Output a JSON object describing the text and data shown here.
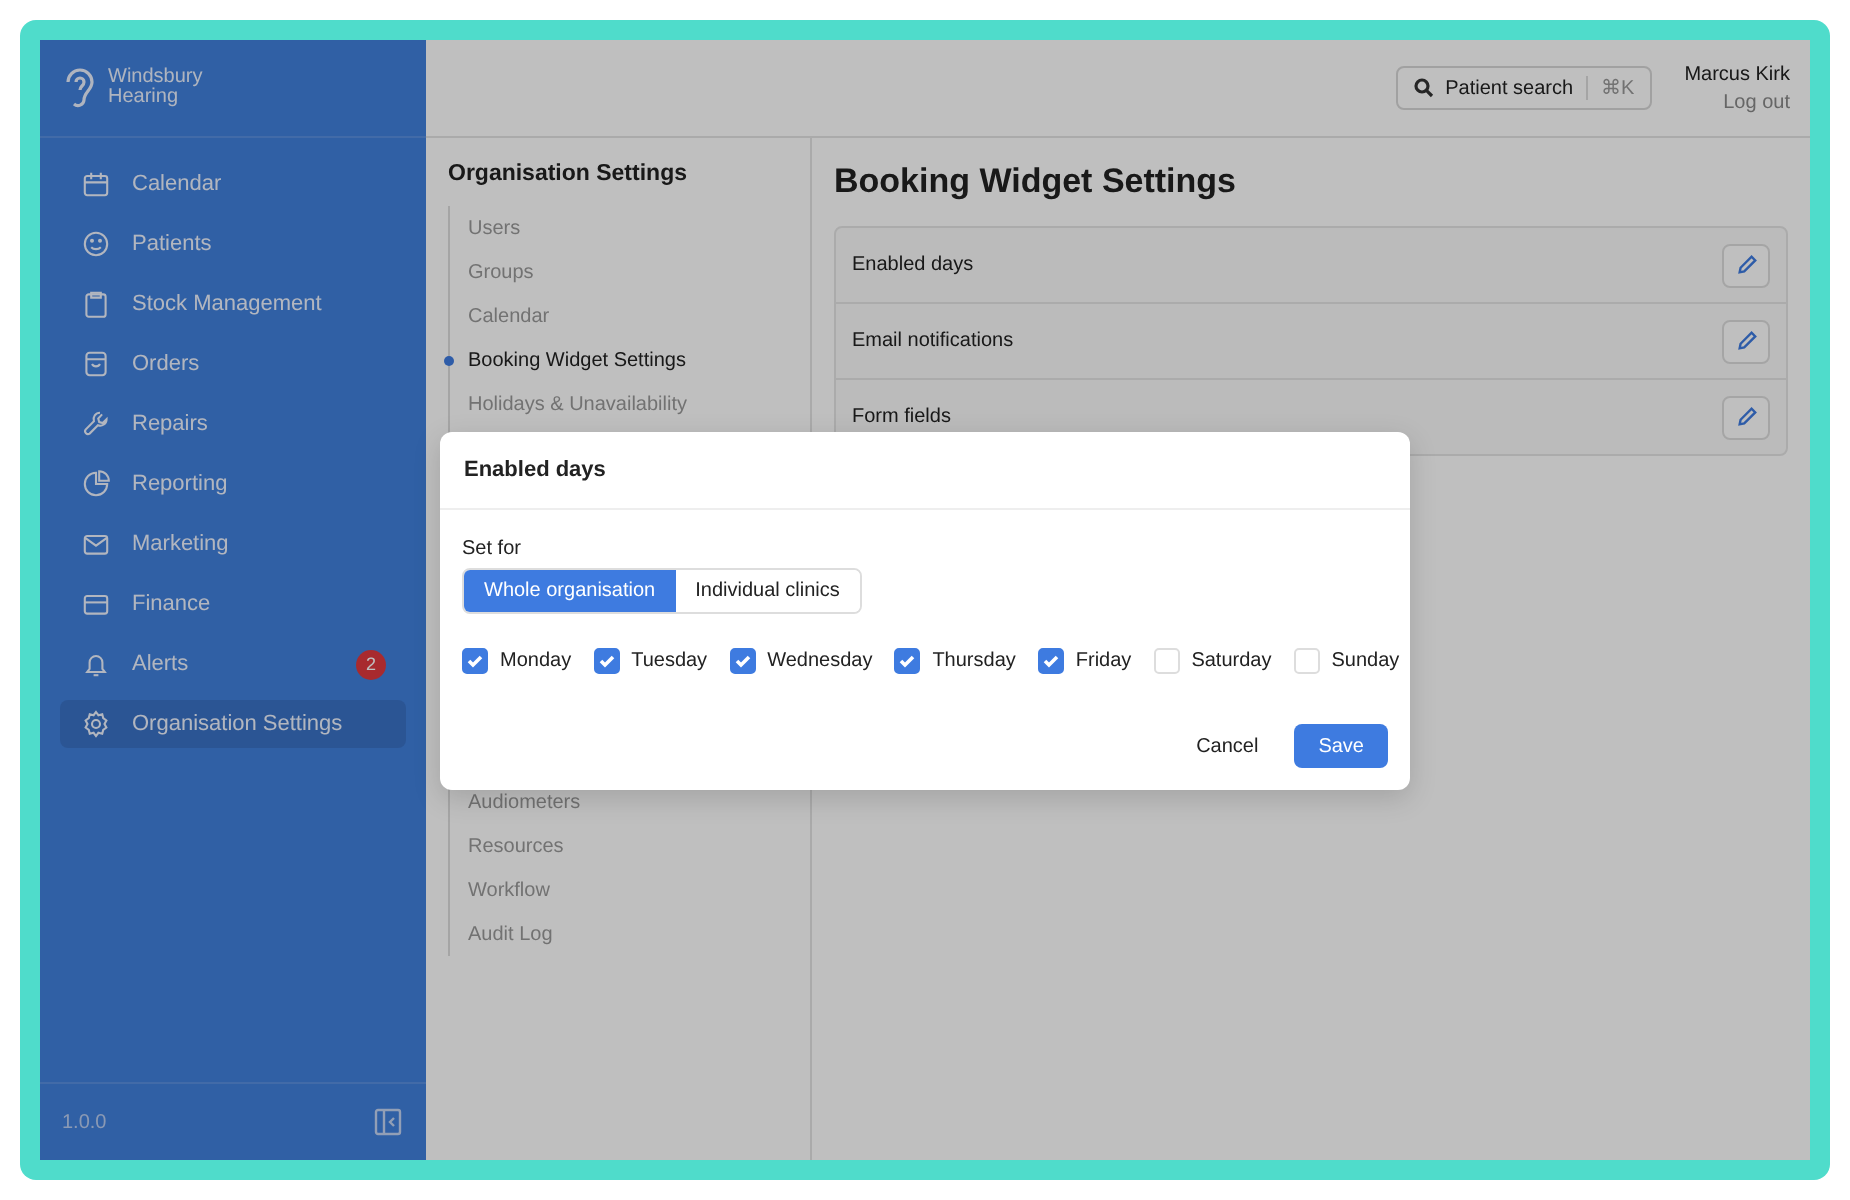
{
  "brand": {
    "name_line1": "Windsbury",
    "name_line2": "Hearing"
  },
  "sidebar": {
    "items": [
      {
        "label": "Calendar",
        "selected": false
      },
      {
        "label": "Patients",
        "selected": false
      },
      {
        "label": "Stock Management",
        "selected": false
      },
      {
        "label": "Orders",
        "selected": false
      },
      {
        "label": "Repairs",
        "selected": false
      },
      {
        "label": "Reporting",
        "selected": false
      },
      {
        "label": "Marketing",
        "selected": false
      },
      {
        "label": "Finance",
        "selected": false
      },
      {
        "label": "Alerts",
        "selected": false,
        "badge": "2"
      },
      {
        "label": "Organisation Settings",
        "selected": true
      }
    ],
    "version": "1.0.0"
  },
  "header": {
    "search": {
      "label": "Patient search",
      "shortcut": "⌘K"
    },
    "user": {
      "name": "Marcus Kirk",
      "logout": "Log out"
    }
  },
  "settings_nav": {
    "title": "Organisation Settings",
    "items_top": [
      {
        "label": "Users",
        "selected": false
      },
      {
        "label": "Groups",
        "selected": false
      },
      {
        "label": "Calendar",
        "selected": false
      },
      {
        "label": "Booking Widget Settings",
        "selected": true
      },
      {
        "label": "Holidays & Unavailability",
        "selected": false
      }
    ],
    "items_bottom": [
      {
        "label": "Audiometers",
        "selected": false
      },
      {
        "label": "Resources",
        "selected": false
      },
      {
        "label": "Workflow",
        "selected": false
      },
      {
        "label": "Audit Log",
        "selected": false
      }
    ]
  },
  "page": {
    "title": "Booking Widget Settings",
    "rows": [
      {
        "label": "Enabled days"
      },
      {
        "label": "Email notifications"
      },
      {
        "label": "Form fields"
      }
    ]
  },
  "modal": {
    "title": "Enabled days",
    "set_for_label": "Set for",
    "options": [
      {
        "label": "Whole organisation",
        "selected": true
      },
      {
        "label": "Individual clinics",
        "selected": false
      }
    ],
    "days": [
      {
        "label": "Monday",
        "checked": true
      },
      {
        "label": "Tuesday",
        "checked": true
      },
      {
        "label": "Wednesday",
        "checked": true
      },
      {
        "label": "Thursday",
        "checked": true
      },
      {
        "label": "Friday",
        "checked": true
      },
      {
        "label": "Saturday",
        "checked": false
      },
      {
        "label": "Sunday",
        "checked": false
      }
    ],
    "buttons": {
      "cancel": "Cancel",
      "save": "Save"
    }
  }
}
